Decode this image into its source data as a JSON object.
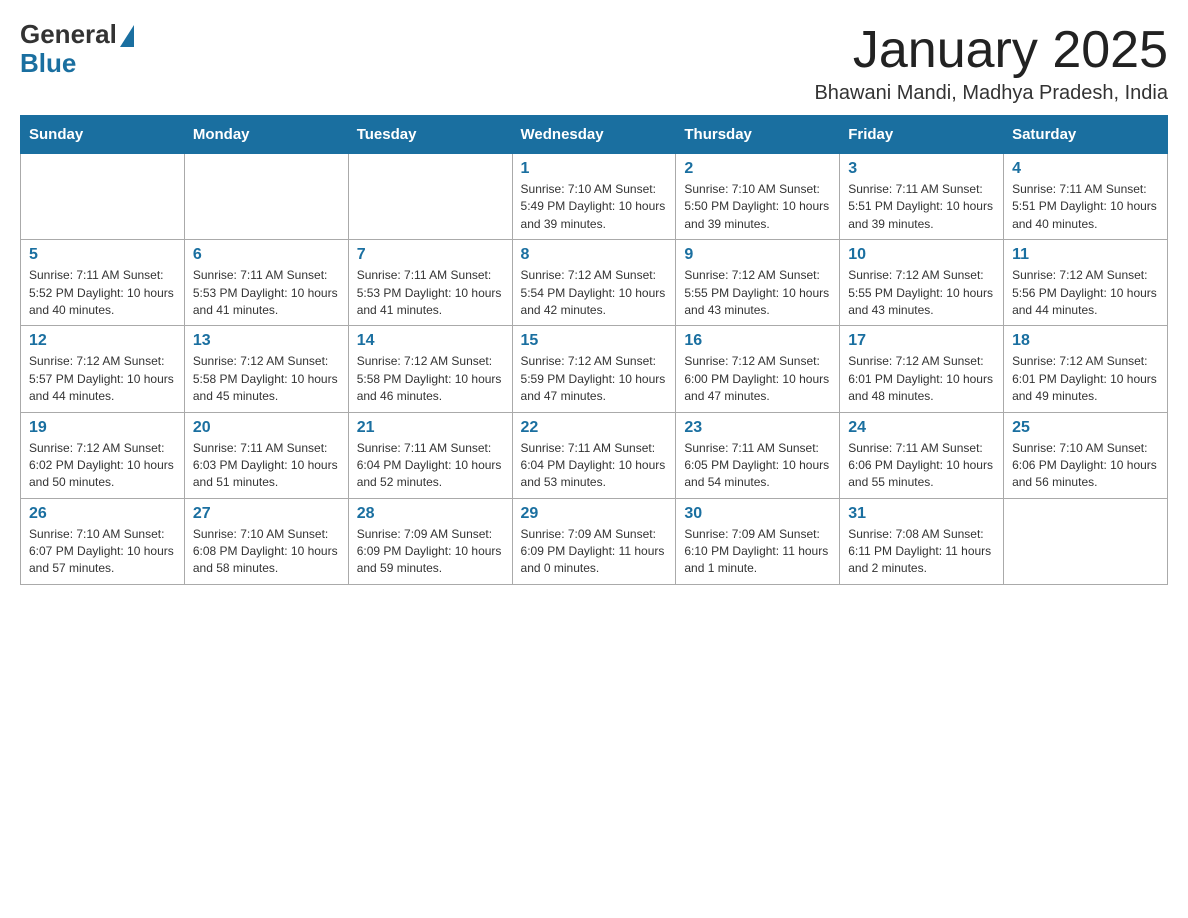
{
  "header": {
    "month_title": "January 2025",
    "location": "Bhawani Mandi, Madhya Pradesh, India",
    "logo_general": "General",
    "logo_blue": "Blue"
  },
  "days_of_week": [
    "Sunday",
    "Monday",
    "Tuesday",
    "Wednesday",
    "Thursday",
    "Friday",
    "Saturday"
  ],
  "weeks": [
    [
      {
        "day": "",
        "info": ""
      },
      {
        "day": "",
        "info": ""
      },
      {
        "day": "",
        "info": ""
      },
      {
        "day": "1",
        "info": "Sunrise: 7:10 AM\nSunset: 5:49 PM\nDaylight: 10 hours\nand 39 minutes."
      },
      {
        "day": "2",
        "info": "Sunrise: 7:10 AM\nSunset: 5:50 PM\nDaylight: 10 hours\nand 39 minutes."
      },
      {
        "day": "3",
        "info": "Sunrise: 7:11 AM\nSunset: 5:51 PM\nDaylight: 10 hours\nand 39 minutes."
      },
      {
        "day": "4",
        "info": "Sunrise: 7:11 AM\nSunset: 5:51 PM\nDaylight: 10 hours\nand 40 minutes."
      }
    ],
    [
      {
        "day": "5",
        "info": "Sunrise: 7:11 AM\nSunset: 5:52 PM\nDaylight: 10 hours\nand 40 minutes."
      },
      {
        "day": "6",
        "info": "Sunrise: 7:11 AM\nSunset: 5:53 PM\nDaylight: 10 hours\nand 41 minutes."
      },
      {
        "day": "7",
        "info": "Sunrise: 7:11 AM\nSunset: 5:53 PM\nDaylight: 10 hours\nand 41 minutes."
      },
      {
        "day": "8",
        "info": "Sunrise: 7:12 AM\nSunset: 5:54 PM\nDaylight: 10 hours\nand 42 minutes."
      },
      {
        "day": "9",
        "info": "Sunrise: 7:12 AM\nSunset: 5:55 PM\nDaylight: 10 hours\nand 43 minutes."
      },
      {
        "day": "10",
        "info": "Sunrise: 7:12 AM\nSunset: 5:55 PM\nDaylight: 10 hours\nand 43 minutes."
      },
      {
        "day": "11",
        "info": "Sunrise: 7:12 AM\nSunset: 5:56 PM\nDaylight: 10 hours\nand 44 minutes."
      }
    ],
    [
      {
        "day": "12",
        "info": "Sunrise: 7:12 AM\nSunset: 5:57 PM\nDaylight: 10 hours\nand 44 minutes."
      },
      {
        "day": "13",
        "info": "Sunrise: 7:12 AM\nSunset: 5:58 PM\nDaylight: 10 hours\nand 45 minutes."
      },
      {
        "day": "14",
        "info": "Sunrise: 7:12 AM\nSunset: 5:58 PM\nDaylight: 10 hours\nand 46 minutes."
      },
      {
        "day": "15",
        "info": "Sunrise: 7:12 AM\nSunset: 5:59 PM\nDaylight: 10 hours\nand 47 minutes."
      },
      {
        "day": "16",
        "info": "Sunrise: 7:12 AM\nSunset: 6:00 PM\nDaylight: 10 hours\nand 47 minutes."
      },
      {
        "day": "17",
        "info": "Sunrise: 7:12 AM\nSunset: 6:01 PM\nDaylight: 10 hours\nand 48 minutes."
      },
      {
        "day": "18",
        "info": "Sunrise: 7:12 AM\nSunset: 6:01 PM\nDaylight: 10 hours\nand 49 minutes."
      }
    ],
    [
      {
        "day": "19",
        "info": "Sunrise: 7:12 AM\nSunset: 6:02 PM\nDaylight: 10 hours\nand 50 minutes."
      },
      {
        "day": "20",
        "info": "Sunrise: 7:11 AM\nSunset: 6:03 PM\nDaylight: 10 hours\nand 51 minutes."
      },
      {
        "day": "21",
        "info": "Sunrise: 7:11 AM\nSunset: 6:04 PM\nDaylight: 10 hours\nand 52 minutes."
      },
      {
        "day": "22",
        "info": "Sunrise: 7:11 AM\nSunset: 6:04 PM\nDaylight: 10 hours\nand 53 minutes."
      },
      {
        "day": "23",
        "info": "Sunrise: 7:11 AM\nSunset: 6:05 PM\nDaylight: 10 hours\nand 54 minutes."
      },
      {
        "day": "24",
        "info": "Sunrise: 7:11 AM\nSunset: 6:06 PM\nDaylight: 10 hours\nand 55 minutes."
      },
      {
        "day": "25",
        "info": "Sunrise: 7:10 AM\nSunset: 6:06 PM\nDaylight: 10 hours\nand 56 minutes."
      }
    ],
    [
      {
        "day": "26",
        "info": "Sunrise: 7:10 AM\nSunset: 6:07 PM\nDaylight: 10 hours\nand 57 minutes."
      },
      {
        "day": "27",
        "info": "Sunrise: 7:10 AM\nSunset: 6:08 PM\nDaylight: 10 hours\nand 58 minutes."
      },
      {
        "day": "28",
        "info": "Sunrise: 7:09 AM\nSunset: 6:09 PM\nDaylight: 10 hours\nand 59 minutes."
      },
      {
        "day": "29",
        "info": "Sunrise: 7:09 AM\nSunset: 6:09 PM\nDaylight: 11 hours\nand 0 minutes."
      },
      {
        "day": "30",
        "info": "Sunrise: 7:09 AM\nSunset: 6:10 PM\nDaylight: 11 hours\nand 1 minute."
      },
      {
        "day": "31",
        "info": "Sunrise: 7:08 AM\nSunset: 6:11 PM\nDaylight: 11 hours\nand 2 minutes."
      },
      {
        "day": "",
        "info": ""
      }
    ]
  ]
}
